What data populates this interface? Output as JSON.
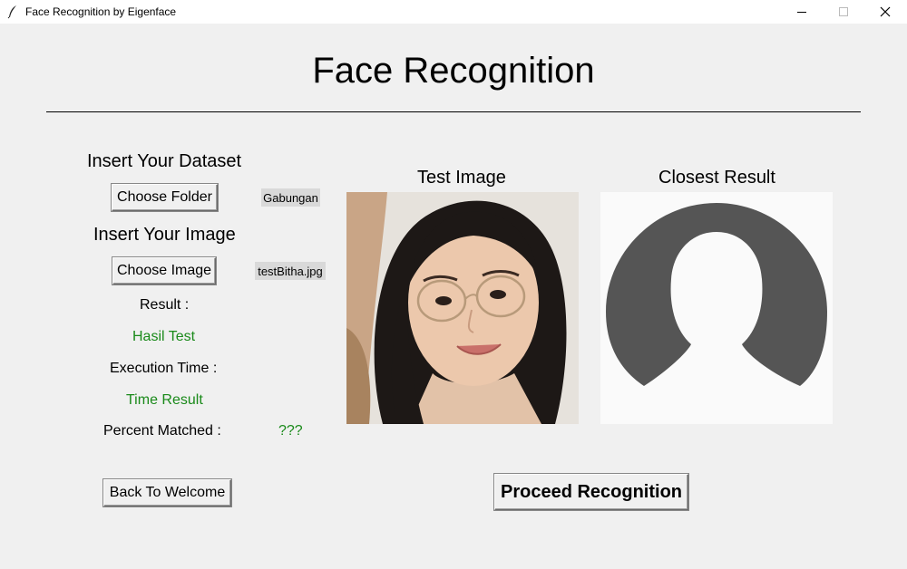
{
  "window": {
    "title": "Face Recognition by Eigenface",
    "icon": "feather-icon",
    "controls": [
      "minimize-icon",
      "maximize-icon",
      "close-icon"
    ]
  },
  "main": {
    "heading": "Face Recognition"
  },
  "left_panel": {
    "dataset_label": "Insert Your Dataset",
    "choose_folder_button": "Choose Folder",
    "folder_value": "Gabungan",
    "image_label": "Insert Your Image",
    "choose_image_button": "Choose Image",
    "image_value": "testBitha.jpg",
    "result_label": "Result :",
    "result_value": "Hasil Test",
    "execution_time_label": "Execution Time :",
    "execution_time_value": "Time Result",
    "percent_label": "Percent Matched :",
    "percent_value": "???",
    "back_button": "Back To Welcome"
  },
  "images": {
    "test_title": "Test Image",
    "closest_title": "Closest Result"
  },
  "actions": {
    "proceed_button": "Proceed Recognition"
  },
  "colors": {
    "background": "#f0f0f0",
    "result_text": "#1a8a1a",
    "chip_bg": "#d9d9d9",
    "placeholder_silhouette": "#555555"
  }
}
